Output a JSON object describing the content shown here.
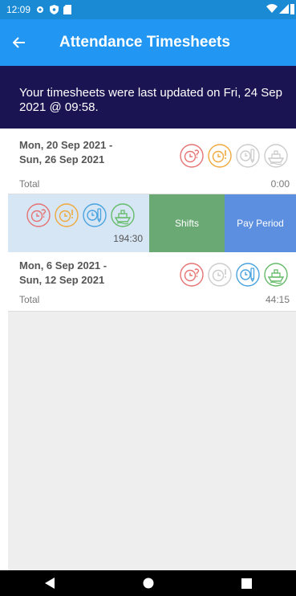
{
  "status_bar": {
    "time": "12:09"
  },
  "app_bar": {
    "title": "Attendance Timesheets"
  },
  "banner": {
    "text": "Your timesheets were last updated on Fri, 24 Sep 2021 @ 09:58."
  },
  "timesheets": [
    {
      "range_line1": "Mon, 20 Sep 2021 -",
      "range_line2": "Sun, 26 Sep 2021",
      "total_label": "Total",
      "total_value": "0:00",
      "icons": [
        "late-clock-question-icon",
        "overtime-clock-alert-icon",
        "clock-pencil-icon",
        "ship-icon"
      ],
      "icon_colors": [
        "#e57373",
        "#f0a93d",
        "#cccccc",
        "#cccccc"
      ]
    },
    {
      "total_value": "194:30",
      "icons": [
        "late-clock-question-icon",
        "overtime-clock-alert-icon",
        "clock-pencil-icon",
        "ship-icon"
      ],
      "icon_colors": [
        "#e57373",
        "#f0a93d",
        "#4aa3df",
        "#66bb6a"
      ],
      "actions": {
        "shifts": "Shifts",
        "pay_period": "Pay Period"
      }
    },
    {
      "range_line1": "Mon, 6 Sep 2021 -",
      "range_line2": "Sun, 12 Sep 2021",
      "total_label": "Total",
      "total_value": "44:15",
      "icons": [
        "late-clock-question-icon",
        "overtime-clock-alert-icon",
        "clock-pencil-icon",
        "ship-icon"
      ],
      "icon_colors": [
        "#e57373",
        "#cccccc",
        "#4aa3df",
        "#66bb6a"
      ]
    }
  ]
}
